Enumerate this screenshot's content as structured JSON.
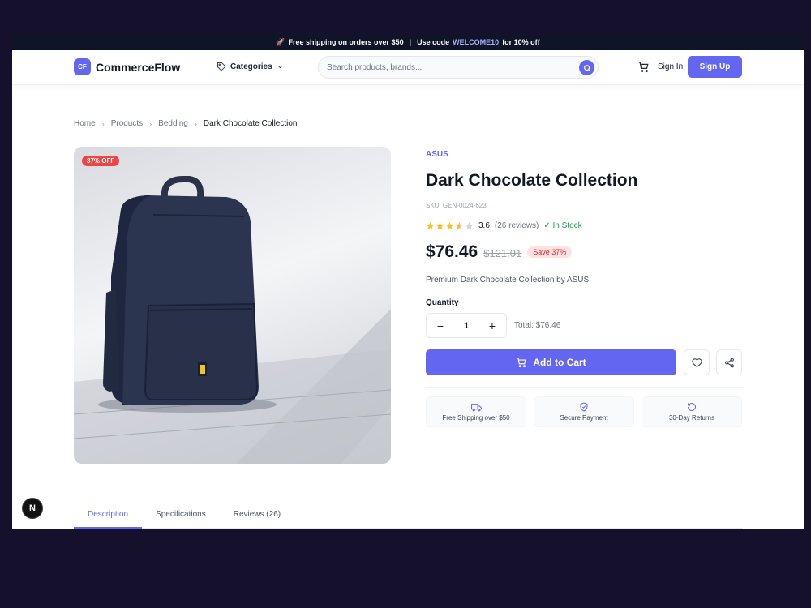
{
  "promo": {
    "icon": "rocket-icon",
    "free_shipping": "Free shipping on orders over $50",
    "separator": "|",
    "code_prefix": "Use code",
    "code": "WELCOME10",
    "code_suffix": "for 10% off"
  },
  "header": {
    "logo_mark": "CF",
    "logo_text": "CommerceFlow",
    "categories_label": "Categories",
    "search_placeholder": "Search products, brands...",
    "signin_label": "Sign In",
    "signup_label": "Sign Up"
  },
  "breadcrumb": {
    "items": [
      "Home",
      "Products",
      "Bedding"
    ],
    "current": "Dark Chocolate Collection"
  },
  "product": {
    "discount_badge": "37% OFF",
    "image_icon": "backpack-icon",
    "brand": "ASUS",
    "title": "Dark Chocolate Collection",
    "sku": "SKU: GEN-0024-623",
    "rating": 3.6,
    "rating_text": "3.6",
    "reviews_text": "(26 reviews)",
    "stock_text": "✓ In Stock",
    "price": "$76.46",
    "old_price": "$121.01",
    "save_text": "Save 37%",
    "description": "Premium Dark Chocolate Collection by ASUS.",
    "quantity_label": "Quantity",
    "quantity": "1",
    "minus": "−",
    "plus": "+",
    "total_text": "Total: $76.46",
    "add_to_cart": "Add to Cart"
  },
  "features": [
    {
      "icon": "truck-icon",
      "label": "Free Shipping over $50"
    },
    {
      "icon": "shield-check-icon",
      "label": "Secure Payment"
    },
    {
      "icon": "rotate-icon",
      "label": "30-Day Returns"
    }
  ],
  "tabs": [
    {
      "label": "Description",
      "active": true
    },
    {
      "label": "Specifications",
      "active": false
    },
    {
      "label": "Reviews (26)",
      "active": false
    }
  ],
  "dev_badge": "N",
  "colors": {
    "accent": "#6366f1",
    "promo_bg": "#0f1428",
    "page_bg": "#15112d",
    "sale_red": "#ef4444",
    "stock_green": "#16a34a",
    "star": "#fbbf24"
  }
}
